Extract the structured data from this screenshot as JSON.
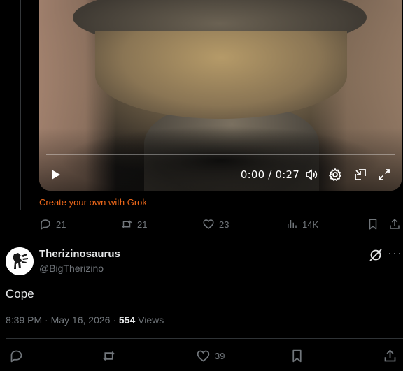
{
  "video": {
    "time": "0:00 / 0:27",
    "progress": 0
  },
  "grok_link": "Create your own with Grok",
  "quoted_actions": {
    "replies": "21",
    "reposts": "21",
    "likes": "23",
    "views": "14K"
  },
  "tweet": {
    "name": "Therizinosaurus",
    "handle": "@BigTherizino",
    "text": "Cope",
    "time": "8:39 PM",
    "sep1": " · ",
    "date": "May 16, 2026",
    "sep2": " · ",
    "views_count": "554",
    "views_label": " Views"
  },
  "tweet_actions": {
    "likes": "39"
  },
  "colors": {
    "background": "#000000",
    "text": "#e7e9ea",
    "muted": "#71767b",
    "grok_orange": "#f26a1b",
    "accent": "#1d9bf0"
  },
  "icons": [
    "play-icon",
    "volume-icon",
    "settings-icon",
    "pip-icon",
    "fullscreen-icon",
    "reply-icon",
    "repost-icon",
    "like-icon",
    "views-icon",
    "bookmark-icon",
    "share-icon",
    "grok-icon",
    "more-icon"
  ]
}
